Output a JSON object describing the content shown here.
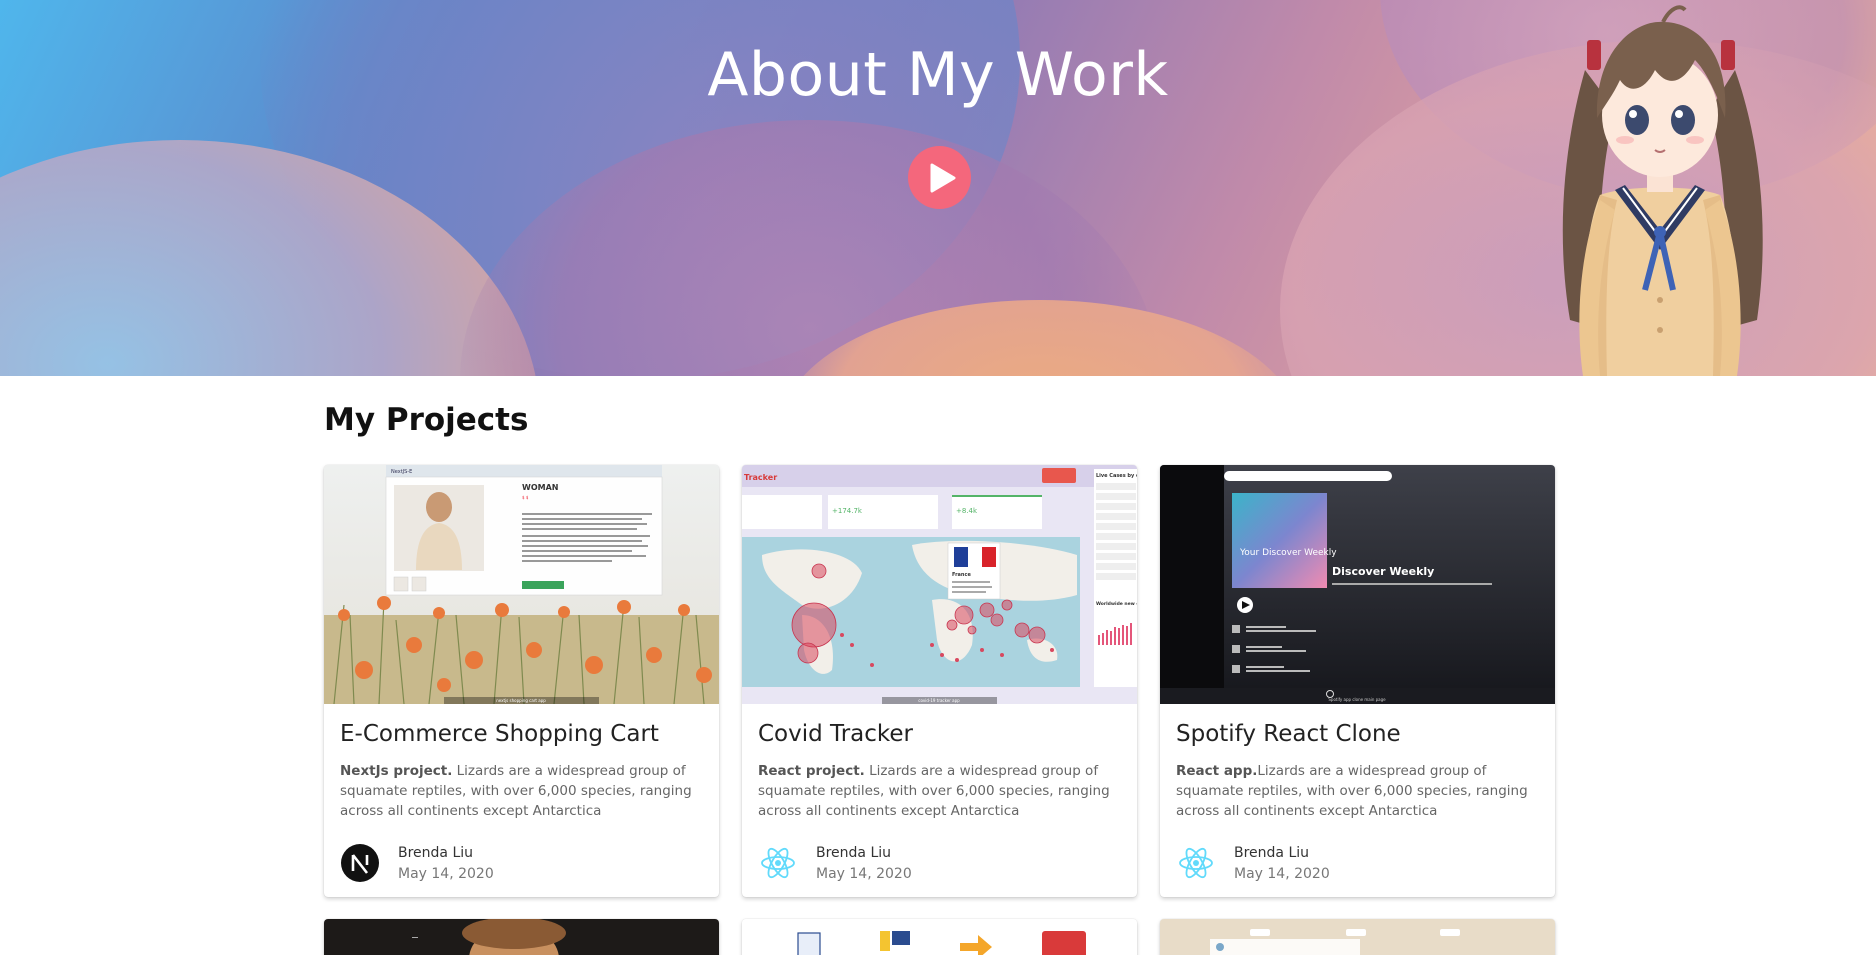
{
  "hero": {
    "title": "About My Work",
    "play_icon": "play-icon",
    "colors": {
      "play": "#f4677c"
    }
  },
  "projects_section": {
    "title": "My Projects",
    "cards": [
      {
        "title": "E-Commerce Shopping Cart",
        "tech": "NextJs project.",
        "description": " Lizards are a widespread group of squamate reptiles, with over 6,000 species, ranging across all continents except Antarctica",
        "author": "Brenda Liu",
        "date": "May 14, 2020",
        "avatar_icon": "nextjs-logo-icon",
        "thumb": {
          "brand": "NextJS-E",
          "heading": "WOMAN",
          "button": "Add to Cart",
          "caption": "nextjs shopping cart app"
        }
      },
      {
        "title": "Covid Tracker",
        "tech": "React project.",
        "description": " Lizards are a widespread group of squamate reptiles, with over 6,000 species, ranging across all continents except Antarctica",
        "author": "Brenda Liu",
        "date": "May 14, 2020",
        "avatar_icon": "react-logo-icon",
        "thumb": {
          "brand": "Tracker",
          "stat1": "+174.7k",
          "stat2": "+8.4k",
          "panel": "Live Cases by co",
          "panel2": "Worldwide new c",
          "country": "France",
          "caption": "covid-19 tracker app"
        }
      },
      {
        "title": "Spotify React Clone",
        "tech": "React app.",
        "description": "Lizards are a widespread group of squamate reptiles, with over 6,000 species, ranging across all continents except Antarctica",
        "author": "Brenda Liu",
        "date": "May 14, 2020",
        "avatar_icon": "react-logo-icon",
        "thumb": {
          "cover": "Your Discover Weekly",
          "heading": "Discover Weekly",
          "caption": "Spotify app clone main page"
        }
      }
    ]
  }
}
